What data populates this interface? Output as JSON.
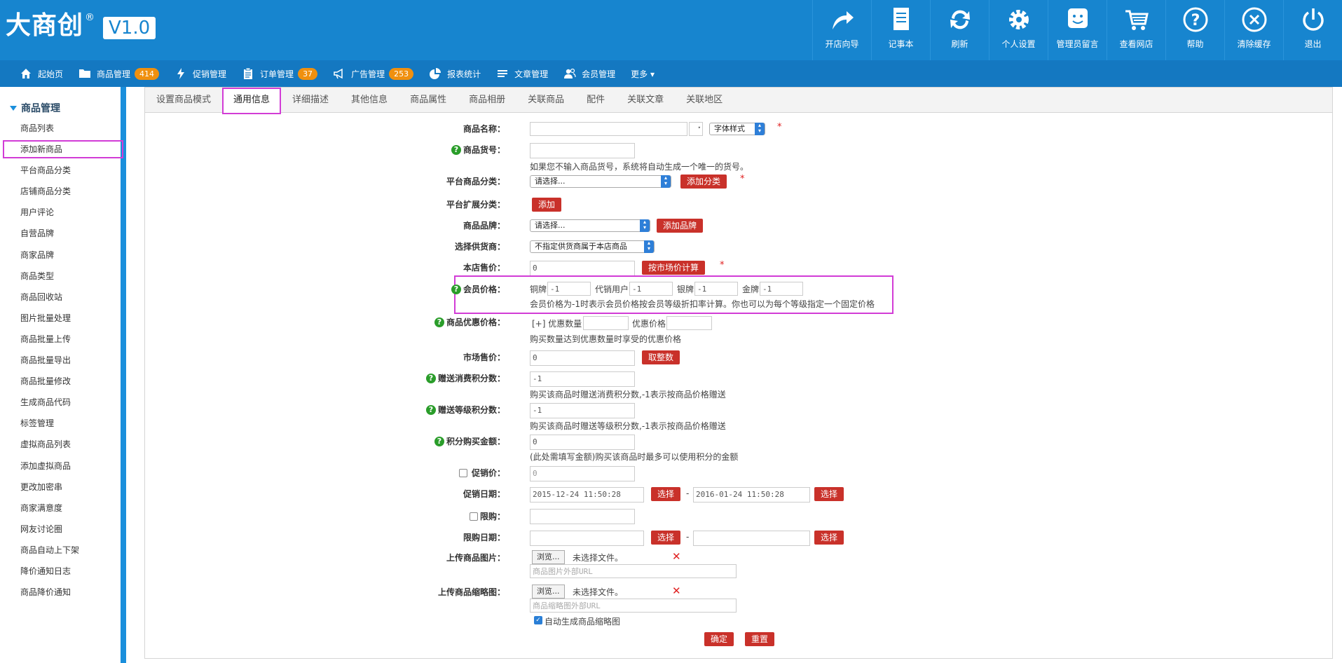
{
  "header": {
    "brand": "大商创",
    "reg": "®",
    "version": "V1.0",
    "tools": [
      {
        "label": "开店向导",
        "icon": "share-arrow-icon"
      },
      {
        "label": "记事本",
        "icon": "notepad-icon"
      },
      {
        "label": "刷新",
        "icon": "refresh-icon"
      },
      {
        "label": "个人设置",
        "icon": "gear-icon"
      },
      {
        "label": "管理员留言",
        "icon": "message-face-icon"
      },
      {
        "label": "查看网店",
        "icon": "cart-icon"
      },
      {
        "label": "帮助",
        "icon": "help-icon"
      },
      {
        "label": "清除缓存",
        "icon": "close-circle-icon"
      },
      {
        "label": "退出",
        "icon": "power-icon"
      }
    ]
  },
  "nav": {
    "items": [
      {
        "label": "起始页",
        "icon": "home-icon",
        "badge": ""
      },
      {
        "label": "商品管理",
        "icon": "folder-icon",
        "badge": "414"
      },
      {
        "label": "促销管理",
        "icon": "lightning-icon",
        "badge": ""
      },
      {
        "label": "订单管理",
        "icon": "clipboard-icon",
        "badge": "37"
      },
      {
        "label": "广告管理",
        "icon": "megaphone-icon",
        "badge": "253"
      },
      {
        "label": "报表统计",
        "icon": "pie-chart-icon",
        "badge": ""
      },
      {
        "label": "文章管理",
        "icon": "list-icon",
        "badge": ""
      },
      {
        "label": "会员管理",
        "icon": "users-icon",
        "badge": ""
      }
    ],
    "more": "更多 ▾"
  },
  "sidebar": {
    "title": "商品管理",
    "items": [
      "商品列表",
      "添加新商品",
      "平台商品分类",
      "店铺商品分类",
      "用户评论",
      "自营品牌",
      "商家品牌",
      "商品类型",
      "商品回收站",
      "图片批量处理",
      "商品批量上传",
      "商品批量导出",
      "商品批量修改",
      "生成商品代码",
      "标签管理",
      "虚拟商品列表",
      "添加虚拟商品",
      "更改加密串",
      "商家满意度",
      "网友讨论圈",
      "商品自动上下架",
      "降价通知日志",
      "商品降价通知"
    ]
  },
  "tabs": [
    "设置商品模式",
    "通用信息",
    "详细描述",
    "其他信息",
    "商品属性",
    "商品相册",
    "关联商品",
    "配件",
    "关联文章",
    "关联地区"
  ],
  "form": {
    "name_label": "商品名称：",
    "font_style": "字体样式",
    "sn_label": "商品货号：",
    "sn_note": "如果您不输入商品货号，系统将自动生成一个唯一的货号。",
    "cat_label": "平台商品分类：",
    "cat_select": "请选择...",
    "add_cat": "添加分类",
    "ext_cat_label": "平台扩展分类：",
    "ext_add": "添加",
    "brand_label": "商品品牌：",
    "brand_select": "请选择...",
    "add_brand": "添加品牌",
    "supplier_label": "选择供货商：",
    "supplier_select": "不指定供货商属于本店商品",
    "shop_price_label": "本店售价：",
    "shop_price": "0",
    "calc_market": "按市场价计算",
    "member_price_label": "会员价格：",
    "member_levels": [
      {
        "name": "铜牌",
        "value": "-1"
      },
      {
        "name": "代销用户",
        "value": "-1"
      },
      {
        "name": "银牌",
        "value": "-1"
      },
      {
        "name": "金牌",
        "value": "-1"
      }
    ],
    "member_note": "会员价格为-1时表示会员价格按会员等级折扣率计算。你也可以为每个等级指定一个固定价格",
    "volume_label": "商品优惠价格：",
    "volume_add": "[+] 优惠数量",
    "volume_price": "优惠价格",
    "volume_note": "购买数量达到优惠数量时享受的优惠价格",
    "market_label": "市场售价：",
    "market_price": "0",
    "get_int": "取整数",
    "give_consume_label": "赠送消费积分数：",
    "give_consume": "-1",
    "give_consume_note": "购买该商品时赠送消费积分数,-1表示按商品价格赠送",
    "give_rank_label": "赠送等级积分数：",
    "give_rank": "-1",
    "give_rank_note": "购买该商品时赠送等级积分数,-1表示按商品价格赠送",
    "integral_label": "积分购买金额：",
    "integral": "0",
    "integral_note": "(此处需填写金额)购买该商品时最多可以使用积分的金额",
    "promote_label": "促销价：",
    "promote_price": "0",
    "promote_date_label": "促销日期：",
    "promote_start": "2015-12-24 11:50:28",
    "promote_end": "2016-01-24 11:50:28",
    "choose": "选择",
    "dash": "-",
    "limit_label": "限购：",
    "limit_date_label": "限购日期：",
    "upload_img_label": "上传商品图片：",
    "upload_thumb_label": "上传商品缩略图：",
    "browse": "浏览...",
    "no_file": "未选择文件。",
    "img_url_placeholder": "商品图片外部URL",
    "thumb_url_placeholder": "商品缩略图外部URL",
    "auto_thumb": "自动生成商品缩略图",
    "confirm": "确定",
    "reset": "重置"
  },
  "colors": {
    "primary": "#1785cf",
    "nav": "#1478c1",
    "red_button": "#c9312a",
    "highlight": "#d23cd6",
    "badge": "#f0900f"
  }
}
